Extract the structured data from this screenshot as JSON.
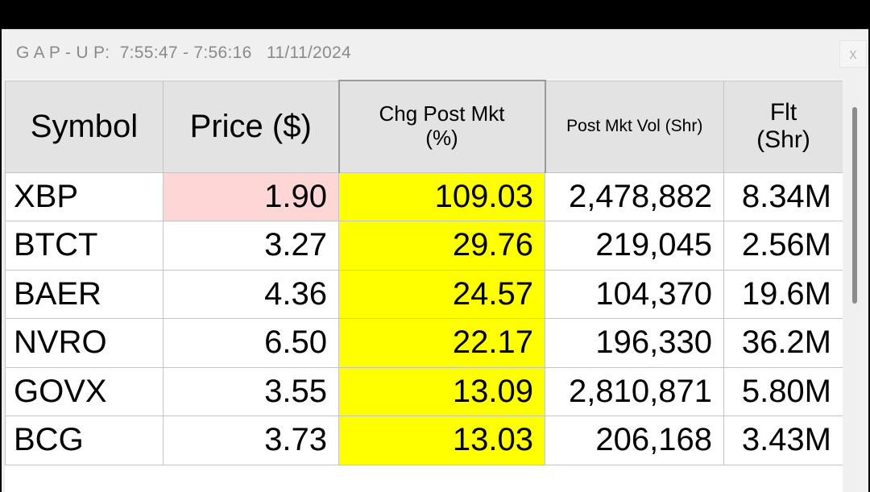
{
  "window": {
    "title": "G A P - U P:  7:55:47 - 7:56:16   11/11/2024",
    "close_label": "x"
  },
  "table": {
    "columns": [
      "Symbol",
      "Price ($)",
      "Chg Post Mkt (%)",
      "Post Mkt Vol (Shr)",
      "Flt (Shr)"
    ],
    "header": {
      "symbol": "Symbol",
      "price": "Price ($)",
      "chg_line1": "Chg Post Mkt",
      "chg_line2": "(%)",
      "vol": "Post Mkt Vol (Shr)",
      "flt_line1": "Flt",
      "flt_line2": "(Shr)"
    },
    "rows": [
      {
        "symbol": "XBP",
        "price": "1.90",
        "chg": "109.03",
        "vol": "2,478,882",
        "flt": "8.34M"
      },
      {
        "symbol": "BTCT",
        "price": "3.27",
        "chg": "29.76",
        "vol": "219,045",
        "flt": "2.56M"
      },
      {
        "symbol": "BAER",
        "price": "4.36",
        "chg": "24.57",
        "vol": "104,370",
        "flt": "19.6M"
      },
      {
        "symbol": "NVRO",
        "price": "6.50",
        "chg": "22.17",
        "vol": "196,330",
        "flt": "36.2M"
      },
      {
        "symbol": "GOVX",
        "price": "3.55",
        "chg": "13.09",
        "vol": "2,810,871",
        "flt": "5.80M"
      },
      {
        "symbol": "BCG",
        "price": "3.73",
        "chg": "13.03",
        "vol": "206,168",
        "flt": "3.43M"
      }
    ]
  },
  "colors": {
    "change_highlight": "#ffff00",
    "price_highlight": "#ffd6d6",
    "header_background": "#e3e3e3",
    "title_text": "#8a8a8a"
  },
  "highlights": {
    "price_highlight_row": 0
  }
}
